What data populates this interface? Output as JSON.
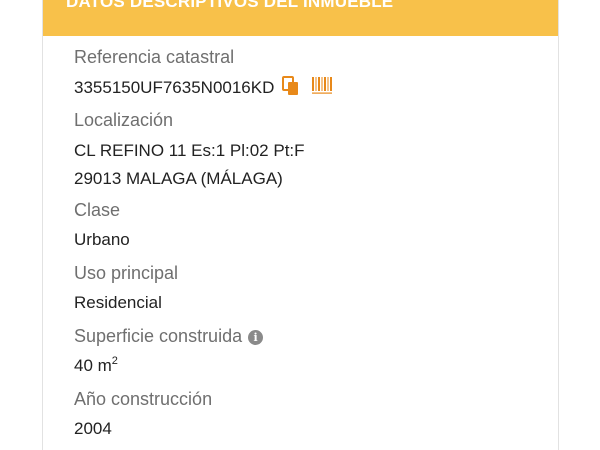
{
  "header": {
    "title": "DATOS DESCRIPTIVOS DEL INMUEBLE"
  },
  "fields": {
    "referencia": {
      "label": "Referencia catastral",
      "value": "3355150UF7635N0016KD"
    },
    "localizacion": {
      "label": "Localización",
      "line1": "CL REFINO 11 Es:1 Pl:02 Pt:F",
      "line2": "29013 MALAGA (MÁLAGA)"
    },
    "clase": {
      "label": "Clase",
      "value": "Urbano"
    },
    "uso": {
      "label": "Uso principal",
      "value": "Residencial"
    },
    "superficie": {
      "label": "Superficie construida",
      "value": "40 m",
      "unit_exponent": "2"
    },
    "anio": {
      "label": "Año construcción",
      "value": "2004"
    }
  },
  "icons": {
    "copy": "copy-icon",
    "barcode": "barcode-icon",
    "info": "info-icon"
  },
  "colors": {
    "header_bg": "#f8c14a",
    "icon_accent": "#e8891a"
  }
}
